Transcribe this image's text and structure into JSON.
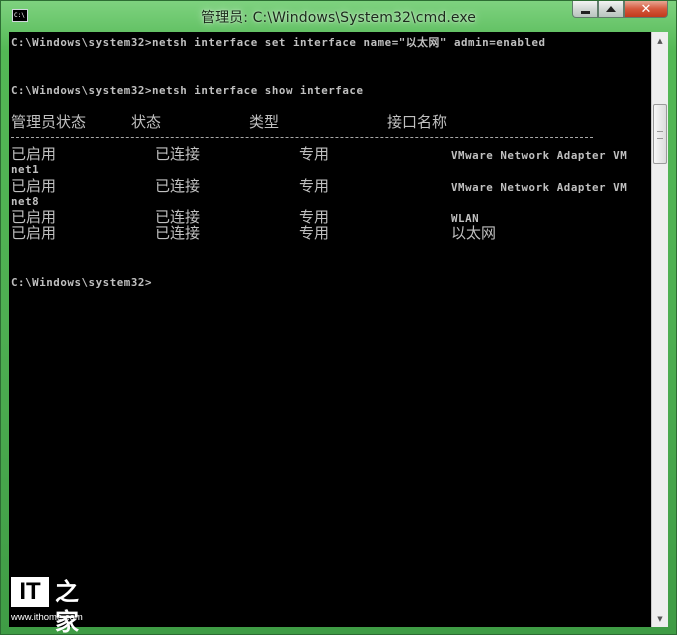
{
  "window": {
    "title": "管理员: C:\\Windows\\System32\\cmd.exe",
    "icon": "cmd-icon",
    "icon_text": "C:\\"
  },
  "caption_buttons": {
    "minimize_icon": "minimize-icon",
    "maximize_icon": "maximize-icon",
    "close_icon": "close-icon",
    "close_glyph": "✕"
  },
  "console": {
    "lines": [
      "C:\\Windows\\system32>netsh interface set interface name=\"以太网\" admin=enabled",
      "C:\\Windows\\system32>netsh interface show interface"
    ],
    "table": {
      "headers": [
        "管理员状态",
        "状态",
        "类型",
        "接口名称"
      ],
      "rows": [
        [
          "已启用",
          "已连接",
          "专用",
          "VMware Network Adapter VM"
        ],
        [
          "已启用",
          "已连接",
          "专用",
          "VMware Network Adapter VM"
        ],
        [
          "已启用",
          "已连接",
          "专用",
          "WLAN"
        ],
        [
          "已启用",
          "已连接",
          "专用",
          "以太网"
        ]
      ],
      "wraps": [
        "net1",
        "net8"
      ]
    },
    "prompt": "C:\\Windows\\system32>"
  },
  "scrollbar": {
    "up_glyph": "▲",
    "down_glyph": "▼"
  },
  "watermark": {
    "logo_left": "IT",
    "logo_right": "之家",
    "url": "www.ithome.com"
  },
  "colors": {
    "console_bg": "#000000",
    "console_text": "#c0c0c0",
    "frame": "#4eaf52"
  }
}
